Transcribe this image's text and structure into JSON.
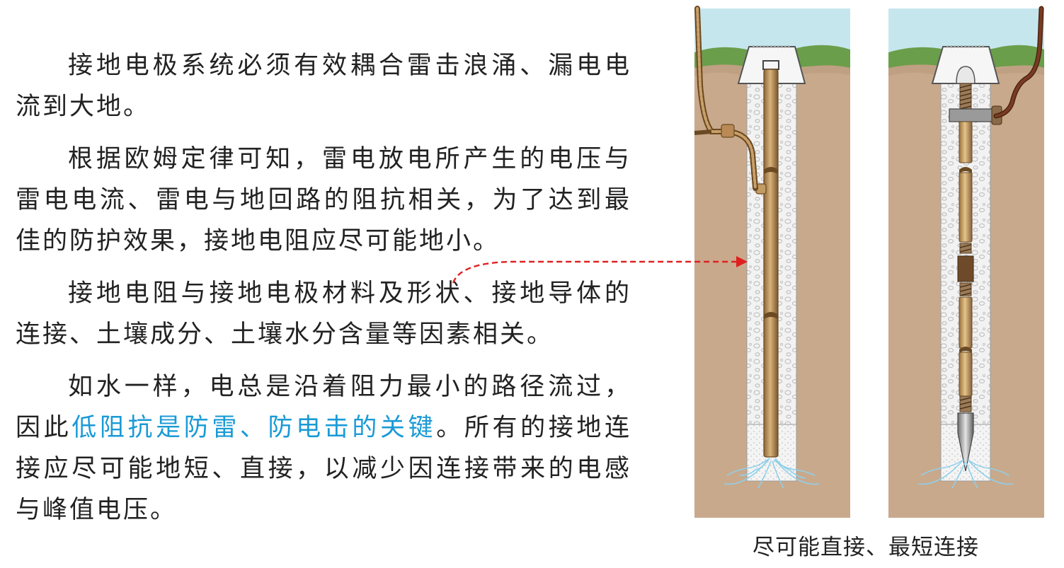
{
  "paragraphs": [
    {
      "text": "接地电极系统必须有效耦合雷击浪涌、漏电电流到大地。"
    },
    {
      "text": "根据欧姆定律可知，雷电放电所产生的电压与雷电电流、雷电与地回路的阻抗相关，为了达到最佳的防护效果，接地电阻应尽可能地小。"
    },
    {
      "text": "接地电阻与接地电极材料及形状、接地导体的连接、土壤成分、土壤水分含量等因素相关。"
    },
    {
      "before": "如水一样，电总是沿着阻力最小的路径流过，因此",
      "highlight": "低阻抗是防雷、防电击的关键",
      "after": "。所有的接地连接应尽可能地短、直接，以减少因连接带来的电感与峰值电压。"
    }
  ],
  "figure": {
    "caption": "尽可能直接、最短连接",
    "colors": {
      "sky": "#c6e6ee",
      "grass": "#6b9e4a",
      "soil": "#c9a98c",
      "fill": "#f0f0f0",
      "rod": "#c29a63",
      "cable": "#7a3b22",
      "arrow": "#e02020",
      "roots": "#8fd0ea",
      "highlight_text": "#1a9ad6"
    }
  }
}
